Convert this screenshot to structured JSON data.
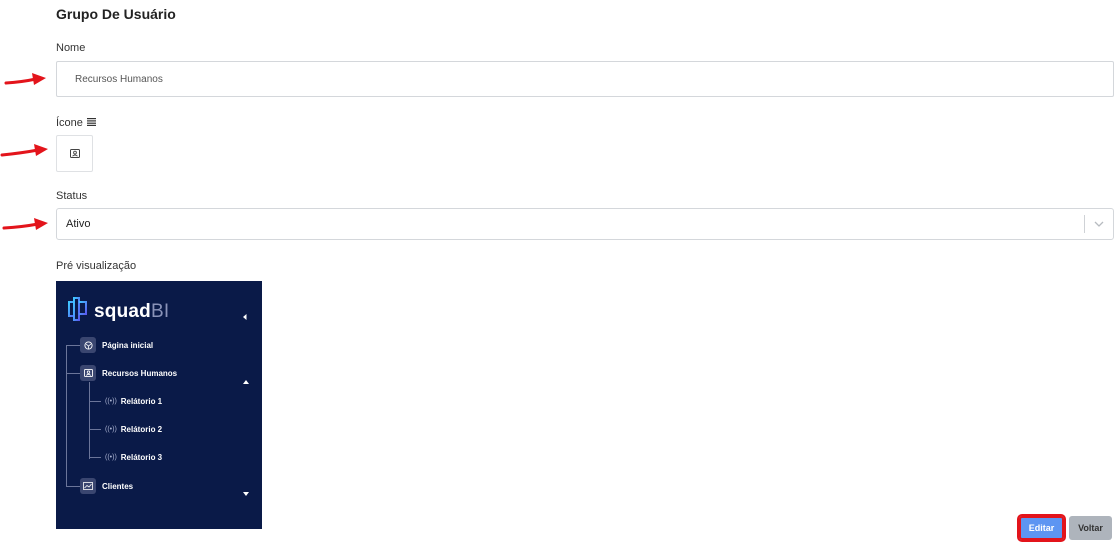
{
  "page": {
    "title": "Grupo De Usuário"
  },
  "form": {
    "nome_label": "Nome",
    "nome_value": "Recursos Humanos",
    "icone_label": "Ícone",
    "icone_list_icon": "list-icon",
    "icone_selected": "id-card-icon",
    "status_label": "Status",
    "status_value": "Ativo",
    "preview_label": "Pré visualização"
  },
  "preview": {
    "brand": "squad",
    "brand_suffix": "BI",
    "items": [
      {
        "label": "Página inicial",
        "icon": "globe-icon"
      },
      {
        "label": "Recursos Humanos",
        "icon": "id-card-icon",
        "expanded": true,
        "children": [
          {
            "label": "Relátorio 1",
            "icon": "broadcast-icon"
          },
          {
            "label": "Relátorio 2",
            "icon": "broadcast-icon"
          },
          {
            "label": "Relátorio 3",
            "icon": "broadcast-icon"
          }
        ]
      },
      {
        "label": "Clientes",
        "icon": "chart-icon",
        "expanded": false
      }
    ]
  },
  "buttons": {
    "editar": "Editar",
    "voltar": "Voltar"
  },
  "colors": {
    "sidebar_bg": "#0a1a48",
    "primary_button": "#5d95f2",
    "secondary_button": "#aeb4bc",
    "annotation_red": "#e3141b"
  }
}
